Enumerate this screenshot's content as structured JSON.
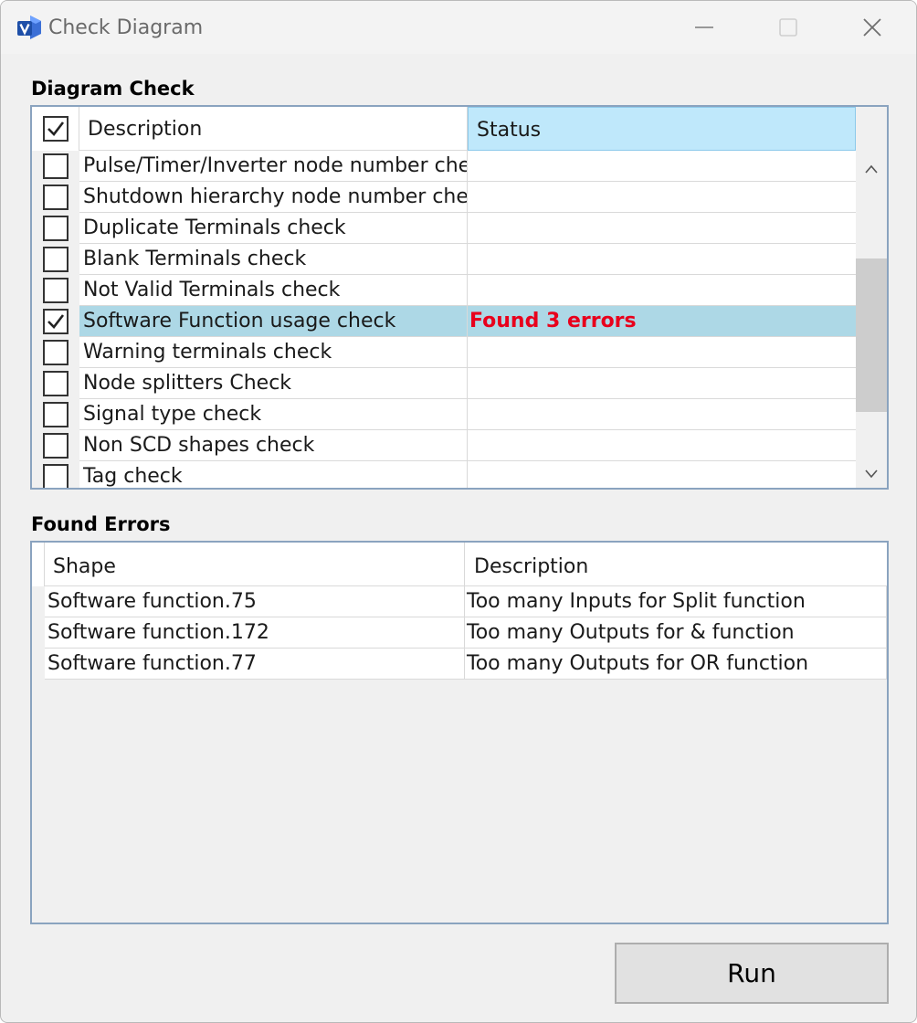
{
  "window": {
    "title": "Check Diagram",
    "icon": "visio-app-icon"
  },
  "diagram_check": {
    "label": "Diagram Check",
    "header": {
      "select_all_checked": true,
      "description": "Description",
      "status": "Status"
    },
    "rows": [
      {
        "checked": false,
        "description": "Pulse/Timer/Inverter node number check",
        "status": ""
      },
      {
        "checked": false,
        "description": "Shutdown hierarchy node number check",
        "status": ""
      },
      {
        "checked": false,
        "description": "Duplicate Terminals check",
        "status": ""
      },
      {
        "checked": false,
        "description": "Blank Terminals check",
        "status": ""
      },
      {
        "checked": false,
        "description": "Not Valid Terminals check",
        "status": ""
      },
      {
        "checked": true,
        "description": "Software Function usage check",
        "status": "Found 3 errors",
        "selected": true
      },
      {
        "checked": false,
        "description": "Warning terminals check",
        "status": ""
      },
      {
        "checked": false,
        "description": "Node splitters Check",
        "status": ""
      },
      {
        "checked": false,
        "description": "Signal type check",
        "status": ""
      },
      {
        "checked": false,
        "description": "Non SCD shapes check",
        "status": ""
      },
      {
        "checked": false,
        "description": "Tag check",
        "status": ""
      }
    ]
  },
  "found_errors": {
    "label": "Found Errors",
    "columns": [
      "Shape",
      "Description"
    ],
    "rows": [
      {
        "shape": "Software function.75",
        "description": "Too many Inputs for Split function"
      },
      {
        "shape": "Software function.172",
        "description": "Too many Outputs for & function"
      },
      {
        "shape": "Software function.77",
        "description": "Too many Outputs for OR function"
      }
    ]
  },
  "actions": {
    "run_label": "Run"
  },
  "colors": {
    "selected_row": "#add8e6",
    "error_status": "#e8001c",
    "status_header": "#bfe8fb",
    "grid_border": "#8aa3bf"
  }
}
